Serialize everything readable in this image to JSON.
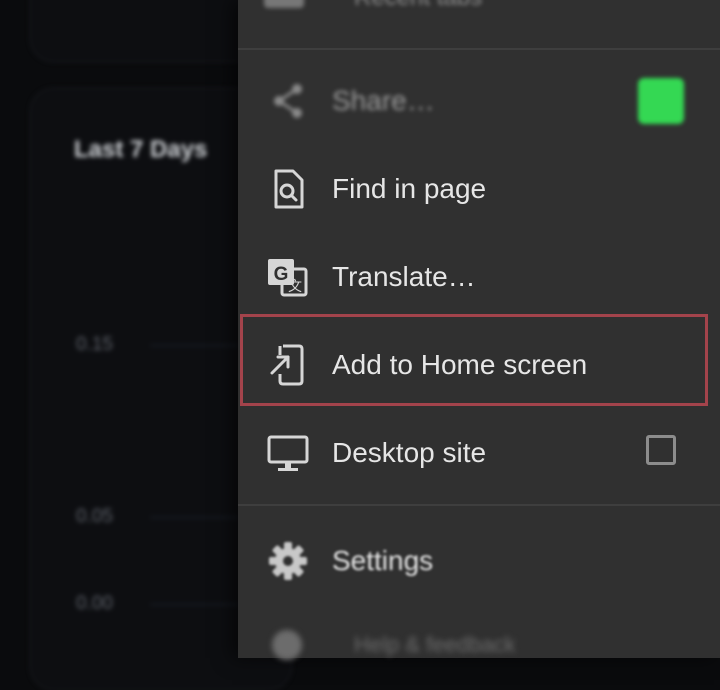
{
  "background": {
    "card_title": "Last 7 Days",
    "y_labels": [
      "0.15",
      "0.05",
      "0.00"
    ]
  },
  "menu": {
    "top_partial_label": "Recent tabs",
    "items": [
      {
        "name": "share",
        "label": "Share…",
        "icon": "share-icon"
      },
      {
        "name": "find-in-page",
        "label": "Find in page",
        "icon": "find-in-page-icon"
      },
      {
        "name": "translate",
        "label": "Translate…",
        "icon": "translate-icon"
      },
      {
        "name": "add-to-home-screen",
        "label": "Add to Home screen",
        "icon": "add-to-home-screen-icon",
        "highlighted": true
      },
      {
        "name": "desktop-site",
        "label": "Desktop site",
        "icon": "desktop-icon",
        "checked": false
      },
      {
        "name": "settings",
        "label": "Settings",
        "icon": "gear-icon"
      }
    ],
    "bottom_partial_label": "Help & feedback"
  },
  "colors": {
    "menu_bg": "#303030",
    "highlight_border": "#a3434b",
    "share_app_accent": "#34d853"
  }
}
